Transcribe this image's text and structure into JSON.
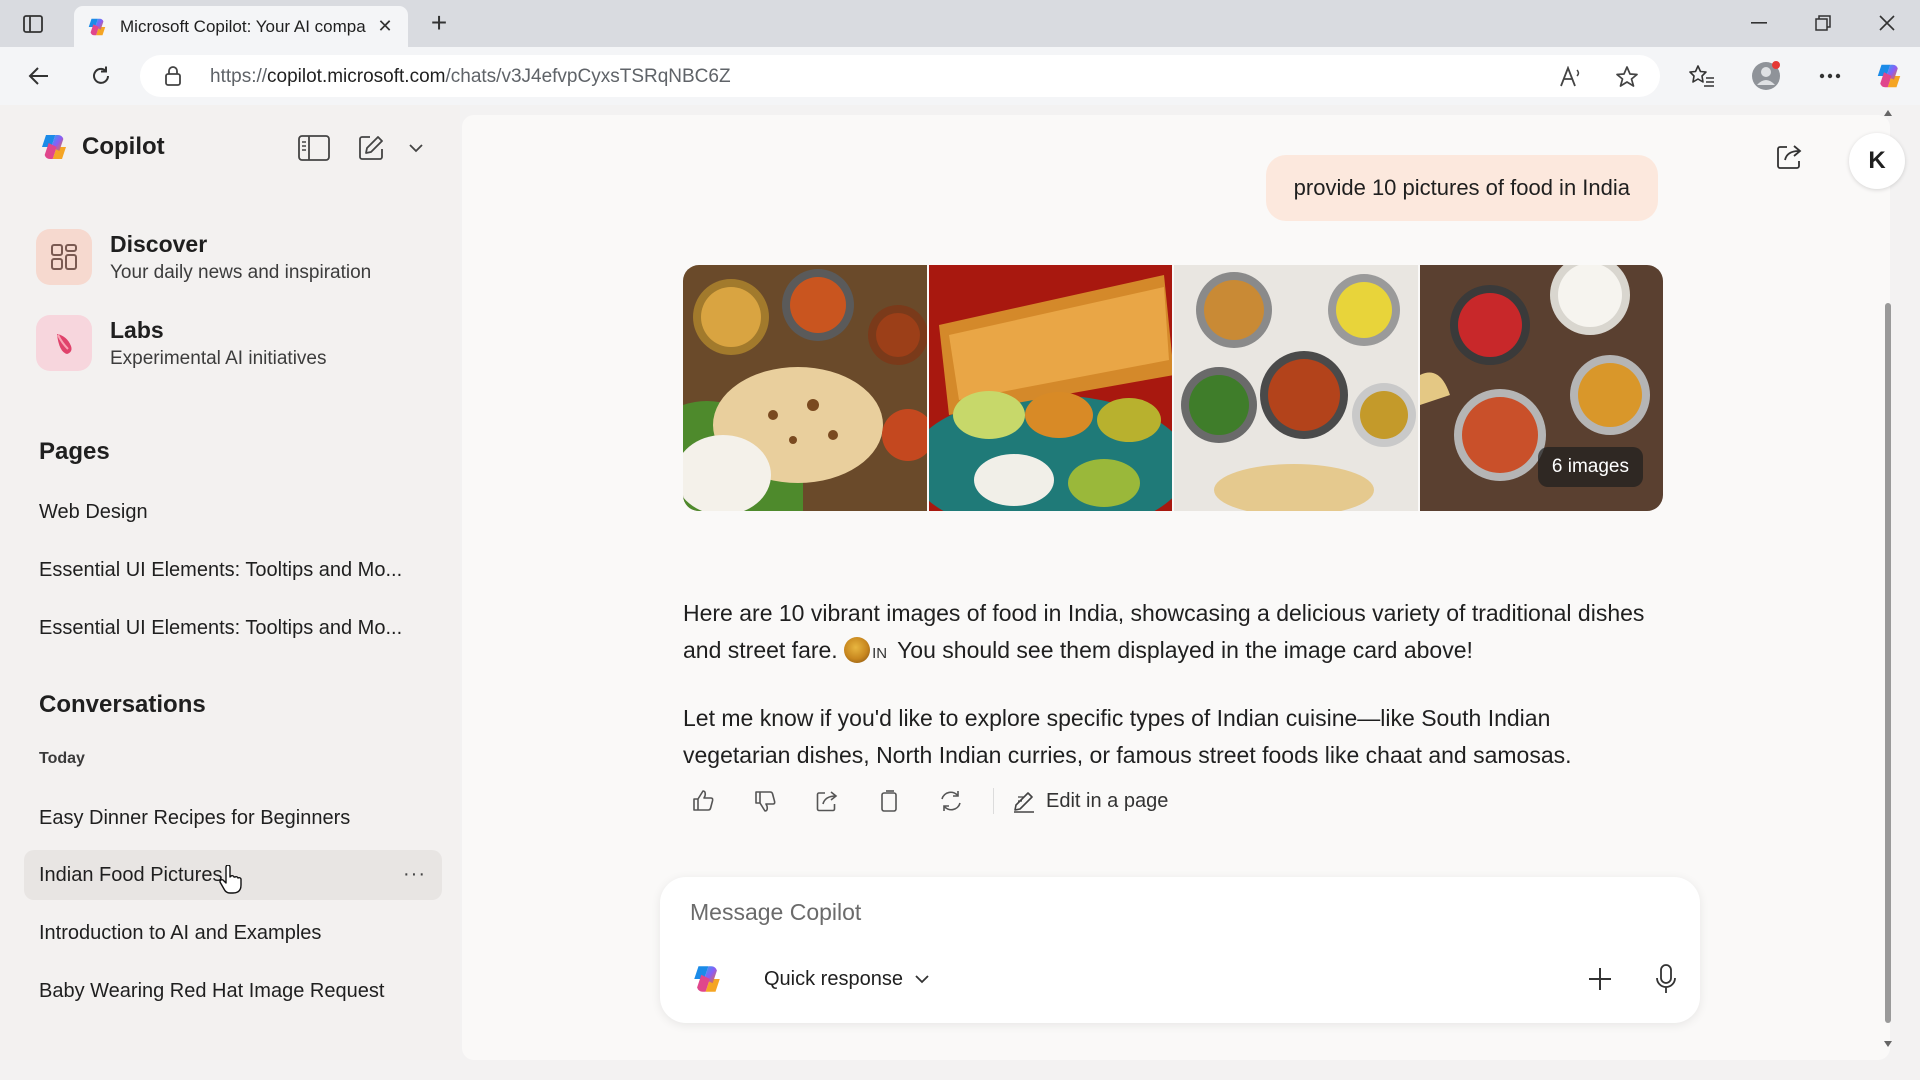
{
  "browser": {
    "tab_title": "Microsoft Copilot: Your AI compa",
    "url_prefix": "https://",
    "url_host": "copilot.microsoft.com",
    "url_path": "/chats/v3J4efvpCyxsTSRqNBC6Z"
  },
  "sidebar": {
    "brand": "Copilot",
    "features": [
      {
        "title": "Discover",
        "subtitle": "Your daily news and inspiration",
        "icon": "grid-icon"
      },
      {
        "title": "Labs",
        "subtitle": "Experimental AI initiatives",
        "icon": "flask-icon"
      }
    ],
    "pages_heading": "Pages",
    "pages": [
      "Web Design",
      "Essential UI Elements: Tooltips and Mo...",
      "Essential UI Elements: Tooltips and Mo..."
    ],
    "conversations_heading": "Conversations",
    "today_label": "Today",
    "conversations": [
      {
        "title": "Easy Dinner Recipes for Beginners",
        "active": false
      },
      {
        "title": "Indian Food Pictures",
        "active": true
      },
      {
        "title": "Introduction to AI and Examples",
        "active": false
      },
      {
        "title": "Baby Wearing Red Hat Image Request",
        "active": false
      }
    ],
    "more_label": "···"
  },
  "chat": {
    "avatar_initial": "K",
    "user_message": "provide 10 pictures of food in India",
    "gallery_count": "6 images",
    "reply_p1_a": "Here are 10 vibrant images of food in India, showcasing a delicious variety of traditional dishes and street fare. ",
    "reply_p1_flag": "IN",
    "reply_p1_b": " You should see them displayed in the image card above!",
    "reply_p2": "Let me know if you'd like to explore specific types of Indian cuisine—like South Indian vegetarian dishes, North Indian curries, or famous street foods like chaat and samosas.",
    "edit_in_page": "Edit in a page"
  },
  "composer": {
    "placeholder": "Message Copilot",
    "mode": "Quick response"
  },
  "colors": {
    "user_bubble": "#fce8dd",
    "sidebar_bg": "#f3f1f0",
    "main_bg": "#faf9f8"
  }
}
